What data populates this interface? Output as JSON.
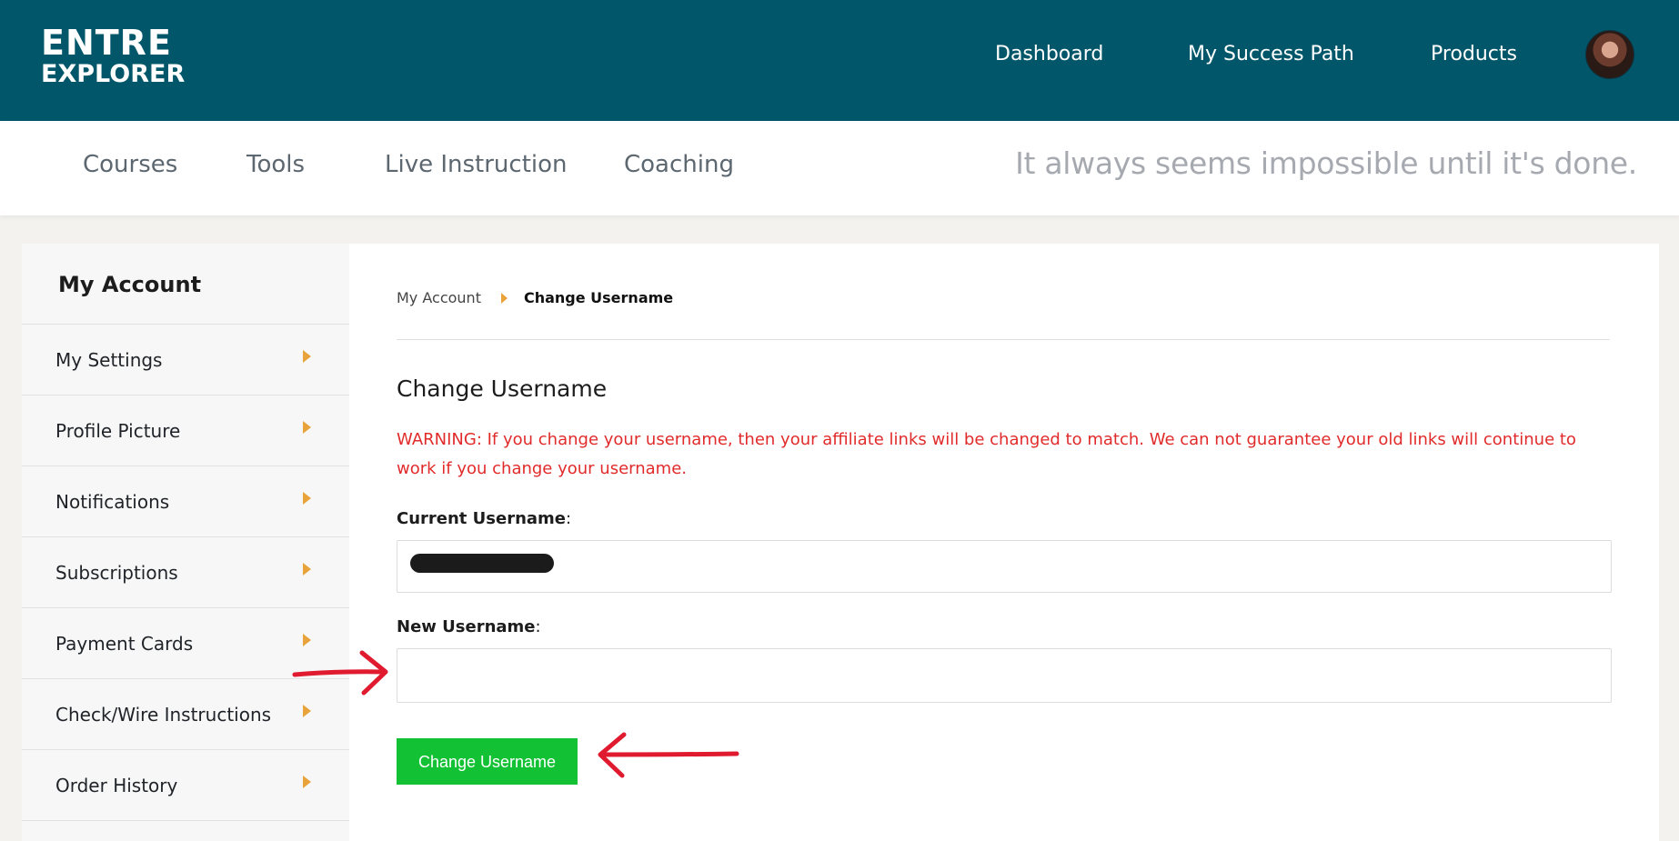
{
  "brand": {
    "line1": "ENTRE",
    "line2": "EXPLORER"
  },
  "top_nav": [
    "Dashboard",
    "My Success Path",
    "Products"
  ],
  "sub_nav": [
    "Courses",
    "Tools",
    "Live Instruction",
    "Coaching"
  ],
  "quote": "It always seems impossible until it's done.",
  "sidebar": {
    "title": "My Account",
    "items": [
      {
        "label": "My Settings"
      },
      {
        "label": "Profile Picture"
      },
      {
        "label": "Notifications"
      },
      {
        "label": "Subscriptions"
      },
      {
        "label": "Payment Cards"
      },
      {
        "label": "Check/Wire Instructions"
      },
      {
        "label": "Order History"
      }
    ]
  },
  "breadcrumb": {
    "parent": "My Account",
    "current": "Change Username"
  },
  "form": {
    "title": "Change Username",
    "warning_prefix": "WARNING",
    "warning_text": ": If you change your username, then your affiliate links will be changed to match. We can not guarantee your old links will continue to work if you change your username.",
    "current_label": "Current Username",
    "new_label": "New Username",
    "label_suffix": ":",
    "new_value": "",
    "submit_label": "Change Username"
  },
  "colors": {
    "header_bg": "#02566a",
    "warning": "#e12b2b",
    "button": "#12c234",
    "caret": "#e8a33a",
    "annotation_arrow": "#e01b2f"
  }
}
